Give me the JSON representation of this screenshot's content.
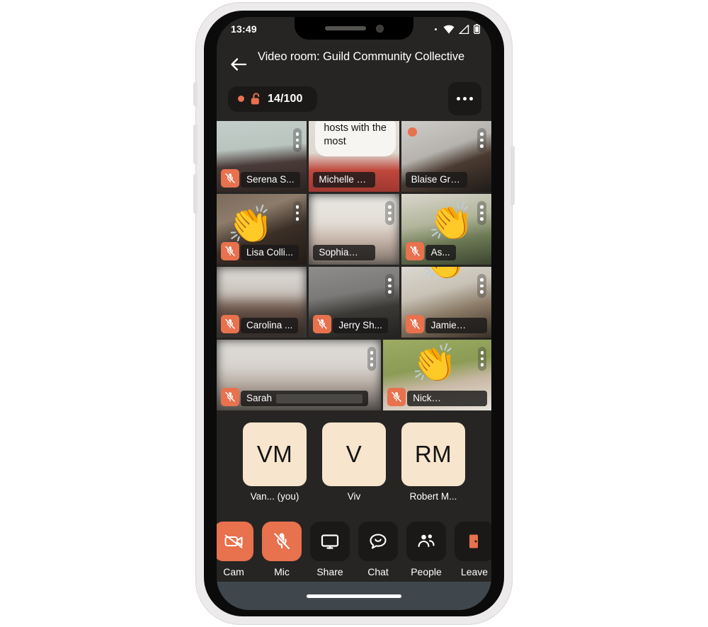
{
  "device": {
    "status_bar": {
      "time": "13:49",
      "icons": [
        "dot-indicator",
        "wifi-icon",
        "signal-icon",
        "battery-icon"
      ]
    },
    "home_indicator": "home-indicator"
  },
  "header": {
    "back_icon": "back-arrow-icon",
    "title": "Video room: Guild Community Collective"
  },
  "info_bar": {
    "recording_dot": "recording-dot",
    "lock_icon": "unlock-icon",
    "capacity": "14/100",
    "more_label": "more-options"
  },
  "speech_bubble": {
    "text": "hosts with the most",
    "owner": "Michelle Goo..."
  },
  "grid": {
    "rows": [
      {
        "tiles": [
          {
            "name": "Serena S...",
            "muted": true,
            "menu": true,
            "speaking": false,
            "clap": false,
            "blurred": false,
            "redacted": false,
            "bg": "serena"
          },
          {
            "name": "Michelle Goo...",
            "muted": false,
            "menu": false,
            "speaking": true,
            "clap": false,
            "blurred": false,
            "redacted": false,
            "bg": "michelle"
          },
          {
            "name": "Blaise Grime...",
            "muted": false,
            "menu": true,
            "speaking": true,
            "clap": false,
            "blurred": false,
            "redacted": false,
            "bg": "blaise"
          }
        ]
      },
      {
        "tiles": [
          {
            "name": "Lisa Colli...",
            "muted": true,
            "menu": true,
            "speaking": false,
            "clap": true,
            "blurred": false,
            "redacted": false,
            "bg": "lisa"
          },
          {
            "name": "Sophia",
            "muted": false,
            "menu": true,
            "speaking": false,
            "clap": false,
            "blurred": true,
            "redacted": true,
            "bg": "sophia"
          },
          {
            "name": "As...",
            "muted": true,
            "menu": true,
            "speaking": false,
            "clap": true,
            "blurred": false,
            "redacted": false,
            "bg": "asha"
          }
        ]
      },
      {
        "tiles": [
          {
            "name": "Carolina ...",
            "muted": true,
            "menu": false,
            "speaking": false,
            "clap": false,
            "blurred": true,
            "redacted": false,
            "bg": "carolina"
          },
          {
            "name": "Jerry Sh...",
            "muted": true,
            "menu": true,
            "speaking": false,
            "clap": false,
            "blurred": false,
            "redacted": false,
            "bg": "jerry"
          },
          {
            "name": "Jamie",
            "muted": true,
            "menu": true,
            "speaking": false,
            "clap": true,
            "blurred": false,
            "redacted": true,
            "bg": "jamie"
          }
        ]
      },
      {
        "tiles": [
          {
            "name": "Sarah",
            "muted": true,
            "menu": true,
            "speaking": false,
            "clap": false,
            "blurred": true,
            "redacted": true,
            "bg": "sarah",
            "wide": true
          },
          {
            "name": "Nick",
            "muted": true,
            "menu": true,
            "speaking": false,
            "clap": true,
            "blurred": false,
            "redacted": true,
            "bg": "nick"
          }
        ]
      }
    ]
  },
  "avatars": [
    {
      "initials": "VM",
      "name": "Van...  (you)"
    },
    {
      "initials": "V",
      "name": "Viv"
    },
    {
      "initials": "RM",
      "name": "Robert M..."
    }
  ],
  "toolbar": [
    {
      "label": "Cam",
      "icon": "camera-off-icon",
      "active": true
    },
    {
      "label": "Mic",
      "icon": "mic-off-icon",
      "active": true
    },
    {
      "label": "Share",
      "icon": "screen-share-icon",
      "active": false
    },
    {
      "label": "Chat",
      "icon": "chat-bubble-icon",
      "active": false
    },
    {
      "label": "People",
      "icon": "people-icon",
      "active": false
    },
    {
      "label": "Leave",
      "icon": "exit-door-icon",
      "active": false
    }
  ],
  "colors": {
    "accent": "#e8714e",
    "screen_bg": "#262523",
    "chip_bg": "#1a1918",
    "avatar_bg": "#f7e5cd",
    "home_bar_bg": "#3f474d"
  }
}
